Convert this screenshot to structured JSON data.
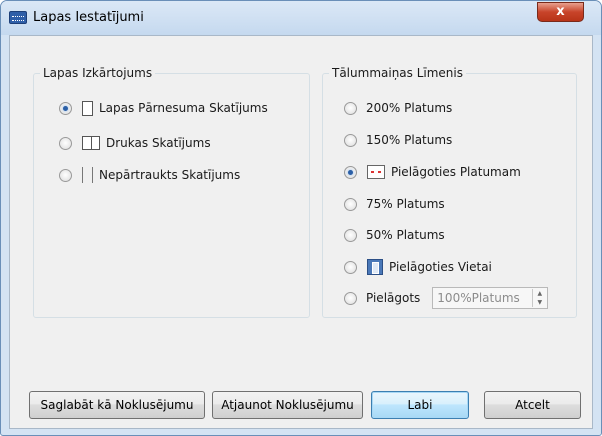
{
  "window": {
    "title": "Lapas Iestatījumi",
    "close_glyph": "x"
  },
  "layout_group": {
    "legend": "Lapas Izkārtojums",
    "options": [
      {
        "label": "Lapas Pārnesuma Skatījums",
        "checked": true,
        "icon": "single-page-icon"
      },
      {
        "label": "Drukas Skatījums",
        "checked": false,
        "icon": "two-page-icon"
      },
      {
        "label": "Nepārtraukts Skatījums",
        "checked": false,
        "icon": "continuous-page-icon"
      }
    ]
  },
  "zoom_group": {
    "legend": "Tālummaiņas Līmenis",
    "options": [
      {
        "label": "200% Platums",
        "checked": false
      },
      {
        "label": "150% Platums",
        "checked": false
      },
      {
        "label": "Pielāgoties Platumam",
        "checked": true,
        "icon": "fit-width-icon"
      },
      {
        "label": "75% Platums",
        "checked": false
      },
      {
        "label": "50% Platums",
        "checked": false
      },
      {
        "label": "Pielāgoties Vietai",
        "checked": false,
        "icon": "fit-page-icon"
      },
      {
        "label": "Pielāgots",
        "checked": false
      }
    ],
    "custom_value": "100%Platums"
  },
  "buttons": {
    "save_default": "Saglabāt kā Noklusējumu",
    "restore_default": "Atjaunot Noklusējumu",
    "ok": "Labi",
    "cancel": "Atcelt"
  },
  "colors": {
    "title_bar": "#c5d9ef",
    "close_button": "#c8442a",
    "default_button": "#bee6fd",
    "radio_selected": "#2b5fa6"
  }
}
